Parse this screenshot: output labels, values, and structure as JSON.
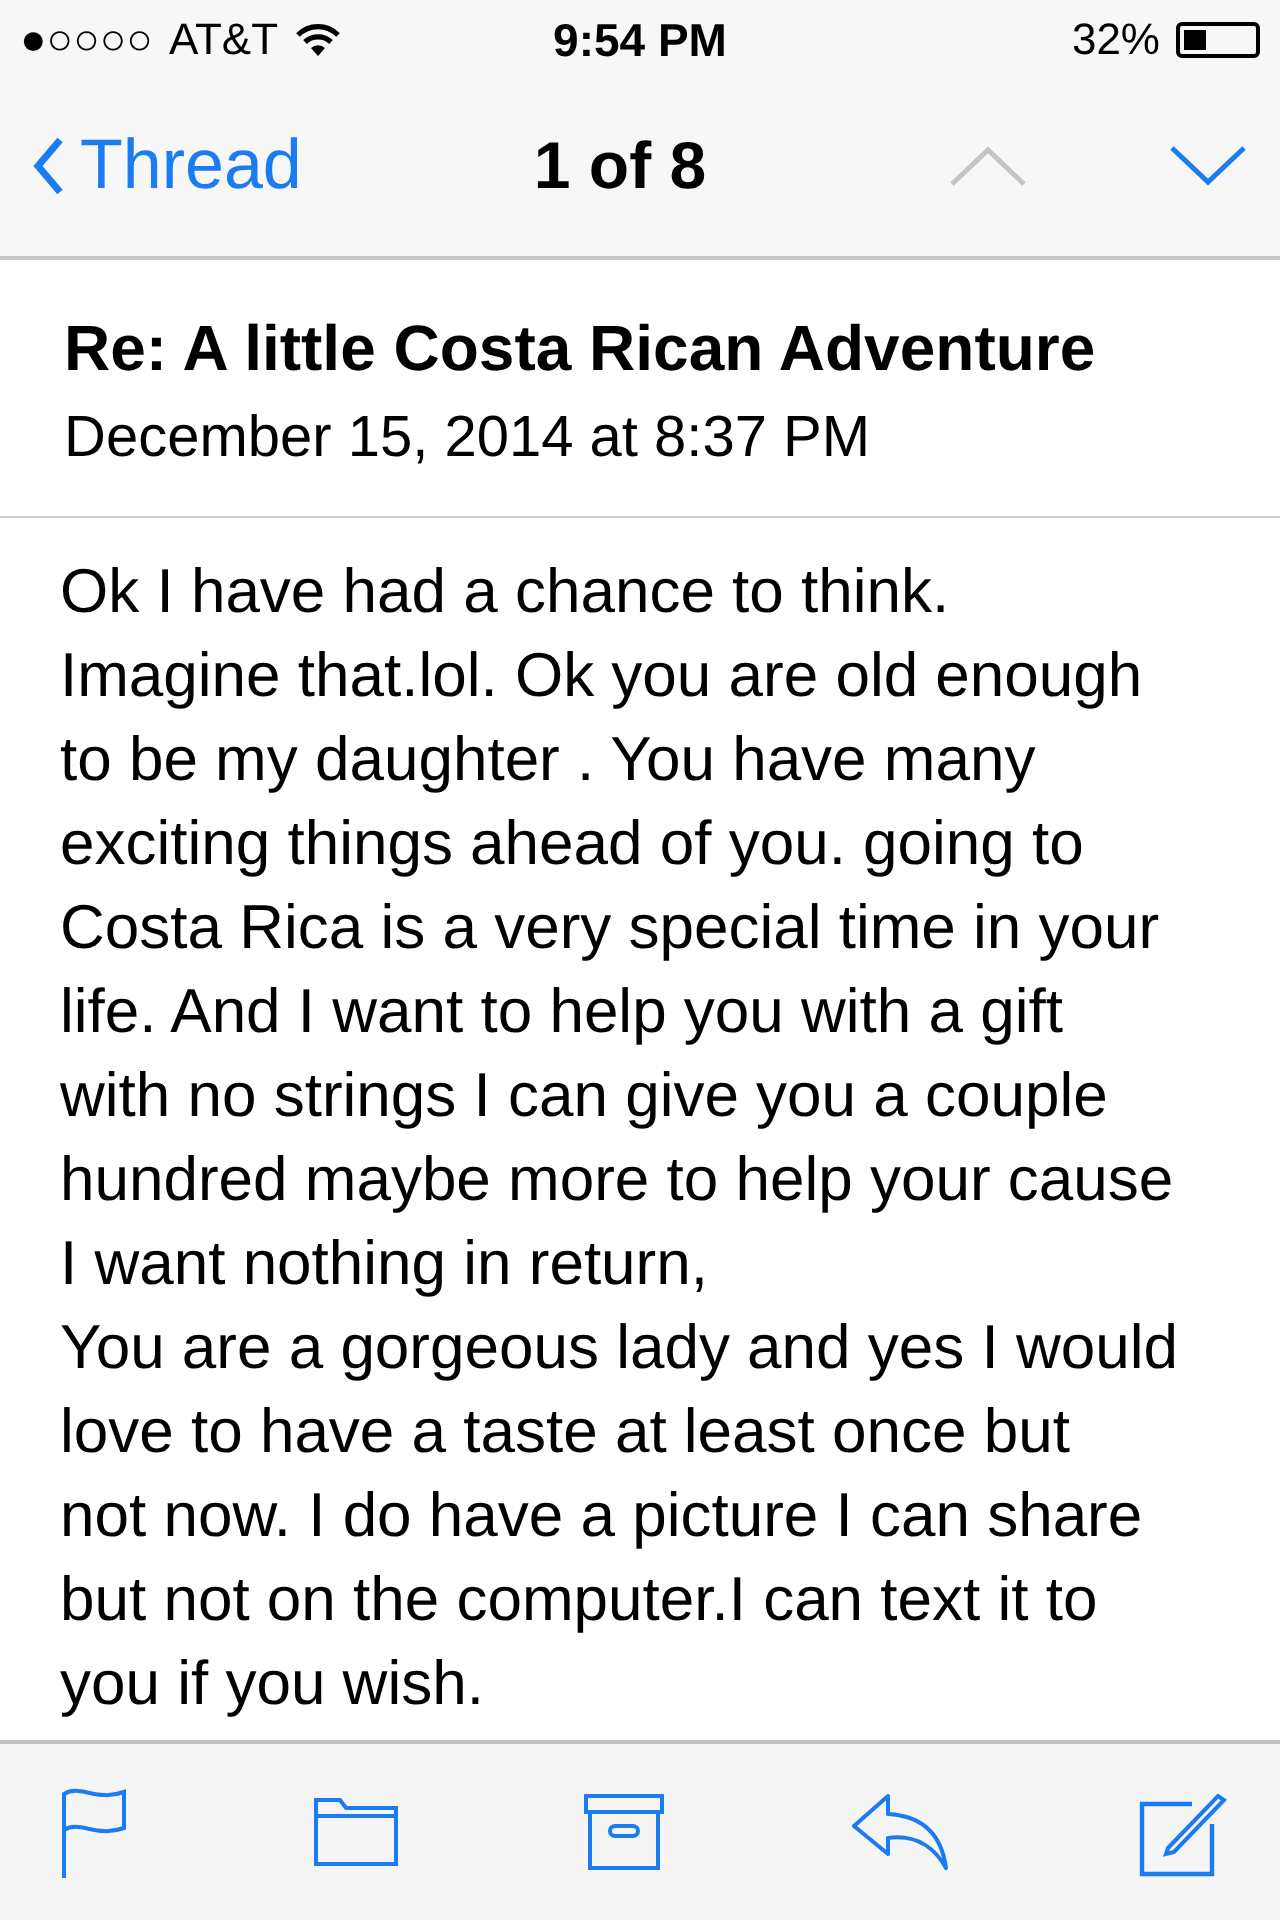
{
  "status_bar": {
    "signal_dots": "●○○○○",
    "carrier": "AT&T",
    "time": "9:54 PM",
    "battery_percent": "32%"
  },
  "nav": {
    "back": "Thread",
    "position": "1 of 8",
    "previous_disabled": true,
    "next_disabled": false
  },
  "message": {
    "subject": "Re: A little Costa Rican Adventure",
    "date": "December 15, 2014 at 8:37 PM",
    "body_lines": [
      "Ok I have had a chance to think.",
      "Imagine that.lol. Ok you are old enough",
      "to be my daughter . You have many",
      "exciting things ahead of you. going to",
      "Costa Rica is a very special time in your",
      "life. And I want to help you with a gift",
      "with no strings I can give you a couple",
      "hundred maybe more to help your cause",
      "I want nothing in return,",
      "You are a gorgeous lady and yes I would",
      "love to have a taste at least once but",
      "not now. I do have a picture I can share",
      "but not on the computer.I can text it to",
      "you if you wish."
    ]
  },
  "toolbar": [
    {
      "kind": "flag"
    },
    {
      "kind": "folder"
    },
    {
      "kind": "archive"
    },
    {
      "kind": "reply"
    },
    {
      "kind": "compose"
    }
  ]
}
